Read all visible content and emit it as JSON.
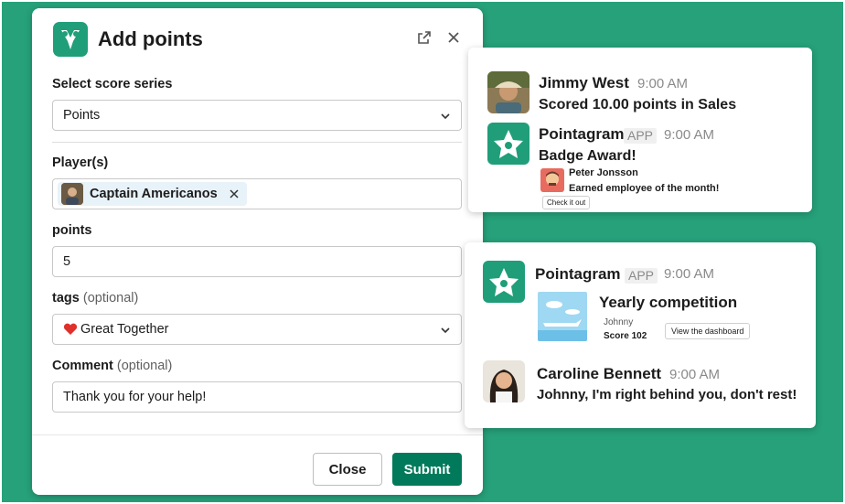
{
  "modal": {
    "title": "Add points",
    "icons": {
      "app": "pointagram-logo-icon",
      "open": "external-link-icon",
      "close": "close-icon"
    },
    "series": {
      "label": "Select score series",
      "value": "Points"
    },
    "players": {
      "label": "Player(s)",
      "selected": [
        {
          "name": "Captain Americanos"
        }
      ]
    },
    "points": {
      "label": "points",
      "value": "5"
    },
    "tags": {
      "label": "tags",
      "optional": "(optional)",
      "value": "Great Together",
      "icon": "heart-icon"
    },
    "comment": {
      "label": "Comment",
      "optional": "(optional)",
      "value": "Thank you for your help!"
    },
    "buttons": {
      "close": "Close",
      "submit": "Submit"
    },
    "accent": "#007a5a"
  },
  "card1": {
    "msg1": {
      "name": "Jimmy West",
      "time": "9:00 AM",
      "text": "Scored 10.00 points in Sales"
    },
    "msg2": {
      "name": "Pointagram",
      "tag": "APP",
      "time": "9:00 AM",
      "text": "Badge Award!",
      "sub_name": "Peter Jonsson",
      "sub_text": "Earned employee of the month!",
      "button": "Check it out"
    }
  },
  "card2": {
    "msg1": {
      "name": "Pointagram",
      "tag": "APP",
      "time": "9:00 AM",
      "title": "Yearly competition",
      "player": "Johnny",
      "score": "Score 102",
      "button": "View the dashboard"
    },
    "msg2": {
      "name": "Caroline Bennett",
      "time": "9:00 AM",
      "text": "Johnny, I'm right behind you, don't rest!"
    }
  },
  "colors": {
    "background": "#26a17a",
    "brand": "#1f9e79"
  }
}
